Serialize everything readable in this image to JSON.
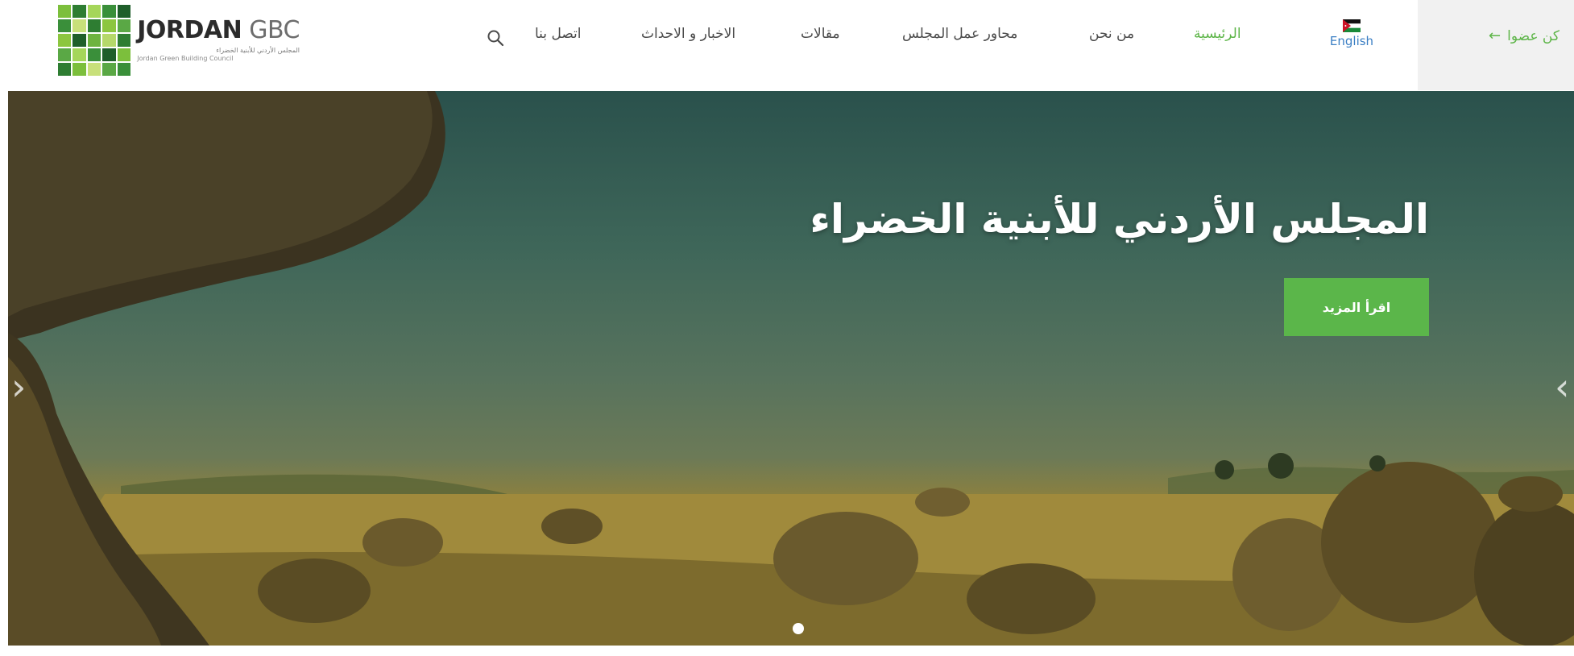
{
  "logo": {
    "title_bold": "JORDAN",
    "title_light": "GBC",
    "subtitle_ar": "المجلس الأردني للأبنية الخضراء",
    "subtitle_en": "Jordan Green Building Council"
  },
  "nav": {
    "items": [
      {
        "label": "الرئيسية",
        "active": true
      },
      {
        "label": "من نحن"
      },
      {
        "label": "محاور عمل المجلس"
      },
      {
        "label": "مقالات"
      },
      {
        "label": "الاخبار و الاحداث"
      },
      {
        "label": "اتصل بنا"
      }
    ],
    "search_icon": "search-icon",
    "language_label": "English",
    "language_flag": "jordan-flag-icon",
    "member_label": "كن عضوا",
    "member_arrow": "arrow-left-icon"
  },
  "hero": {
    "title": "المجلس الأردني للأبنية الخضراء",
    "button_label": "اقرأ المزيد",
    "prev_arrow": "‹",
    "next_arrow": "›",
    "slide_count": 1,
    "active_slide": 1
  },
  "colors": {
    "brand_green": "#5bb64a",
    "nav_text": "#4a4a4a",
    "link_blue": "#3b7fc4",
    "member_bg": "#f1f1f1"
  }
}
